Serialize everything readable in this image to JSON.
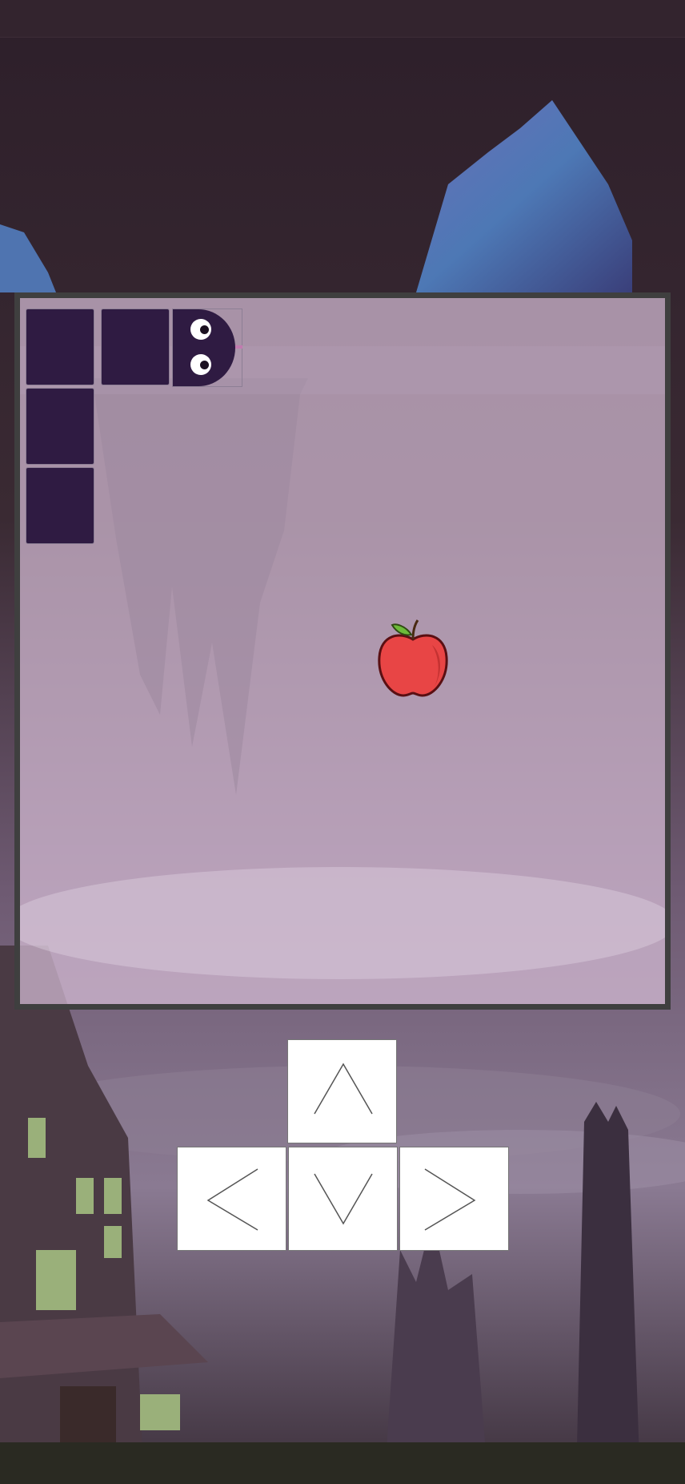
{
  "game": {
    "type": "snake",
    "colors": {
      "snake": "#2f1b42",
      "board_border": "#3f3f3f",
      "board_overlay": "#d6bcd6",
      "apple": "#e84545",
      "background": "#2c2130"
    },
    "snake": {
      "head_direction": "right",
      "segments": 5
    },
    "food": {
      "icon": "apple-icon"
    }
  },
  "controls": {
    "up_icon": "chevron-up-icon",
    "left_icon": "chevron-left-icon",
    "down_icon": "chevron-down-icon",
    "right_icon": "chevron-right-icon"
  }
}
